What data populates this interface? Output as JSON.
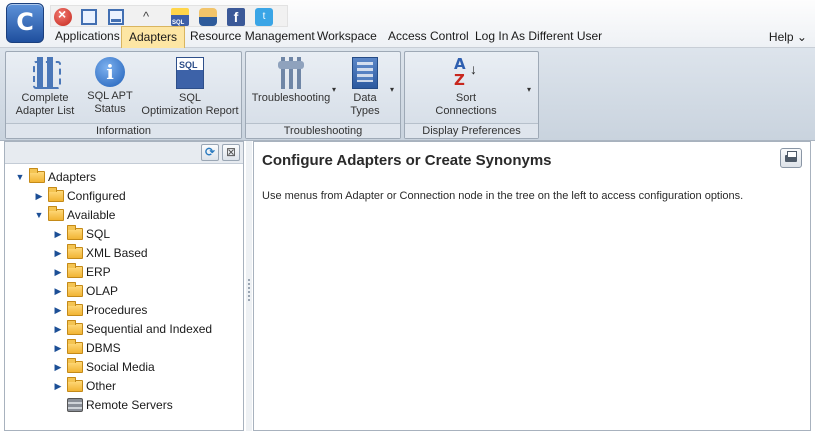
{
  "quick_access": {
    "icons": [
      "close-icon",
      "window-icon",
      "minimize-window-icon",
      "chevron-up-icon",
      "sql-icon",
      "user-icon",
      "facebook-icon",
      "twitter-icon"
    ],
    "facebook_glyph": "f",
    "twitter_glyph": "t",
    "up_glyph": "^"
  },
  "menu": {
    "items": [
      "Applications",
      "Adapters",
      "Resource Management",
      "Workspace",
      "Access Control",
      "Log In As Different User"
    ],
    "active": "Adapters",
    "help": "Help ⌄"
  },
  "ribbon": {
    "groups": [
      {
        "label": "Information",
        "buttons": [
          {
            "line1": "Complete",
            "line2": "Adapter List"
          },
          {
            "line1": "SQL APT",
            "line2": "Status"
          },
          {
            "line1": "SQL",
            "line2": "Optimization Report"
          }
        ]
      },
      {
        "label": "Troubleshooting",
        "buttons": [
          {
            "line1": "Troubleshooting",
            "line2": ""
          },
          {
            "line1": "Data",
            "line2": "Types"
          }
        ]
      },
      {
        "label": "Display Preferences",
        "buttons": [
          {
            "line1": "Sort",
            "line2": "Connections"
          }
        ]
      }
    ],
    "dropdown_glyph": "▾"
  },
  "tree": {
    "toolbar": {
      "refresh": "⟳",
      "collapse": "⊠"
    },
    "nodes": [
      {
        "label": "Adapters",
        "twisty": "▼"
      },
      {
        "label": "Configured",
        "twisty": "▶"
      },
      {
        "label": "Available",
        "twisty": "▼"
      },
      {
        "label": "SQL",
        "twisty": "▶"
      },
      {
        "label": "XML Based",
        "twisty": "▶"
      },
      {
        "label": "ERP",
        "twisty": "▶"
      },
      {
        "label": "OLAP",
        "twisty": "▶"
      },
      {
        "label": "Procedures",
        "twisty": "▶"
      },
      {
        "label": "Sequential and Indexed",
        "twisty": "▶"
      },
      {
        "label": "DBMS",
        "twisty": "▶"
      },
      {
        "label": "Social Media",
        "twisty": "▶"
      },
      {
        "label": "Other",
        "twisty": "▶"
      },
      {
        "label": "Remote Servers",
        "twisty": ""
      }
    ]
  },
  "main": {
    "title": "Configure Adapters or Create Synonyms",
    "description": "Use menus from Adapter or Connection node in the tree on the left to access configuration options."
  },
  "colors": {
    "accent": "#1f4f9e",
    "active_tab": "#fde6a4",
    "folder": "#f1b434",
    "ribbon_bg": "#c9d3de"
  }
}
